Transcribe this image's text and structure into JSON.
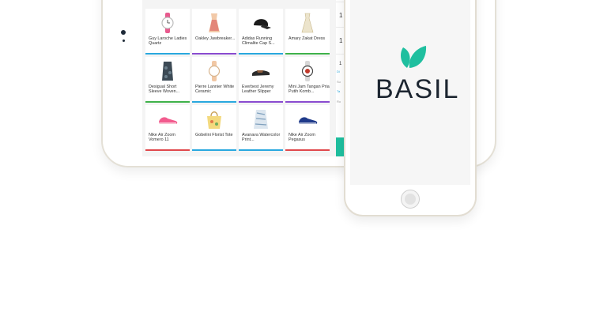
{
  "products": [
    {
      "name": "Guy Laroche Ladies Quartz",
      "color": "#29a8df",
      "icon": "watch-icon"
    },
    {
      "name": "Oakley Jawbreaker...",
      "color": "#8a4bd0",
      "icon": "dress-icon"
    },
    {
      "name": "Adidas Running Climalite Cap S...",
      "color": "#29a8df",
      "icon": "cap-icon"
    },
    {
      "name": "Amary Zakat Dress",
      "color": "#3fb24a",
      "icon": "dress-icon"
    },
    {
      "name": "Desigual Short Sleeve Woven...",
      "color": "#3fb24a",
      "icon": "dress-icon"
    },
    {
      "name": "Pierre Lannier White Ceramic",
      "color": "#29a8df",
      "icon": "watch-icon"
    },
    {
      "name": "Everbest Jeremy Leather Slipper",
      "color": "#8a4bd0",
      "icon": "slipper-icon"
    },
    {
      "name": "Mini Jam Tangan Pria Putih Komb...",
      "color": "#8a4bd0",
      "icon": "watch-icon"
    },
    {
      "name": "Nike Air Zoom Vomero 11",
      "color": "#e0484c",
      "icon": "shoe-icon"
    },
    {
      "name": "Gobelini Florist Tote",
      "color": "#29a8df",
      "icon": "bag-icon"
    },
    {
      "name": "Avanava Watercolor Print...",
      "color": "#29a8df",
      "icon": "top-icon"
    },
    {
      "name": "Nike Air Zoom Pegasus",
      "color": "#e0484c",
      "icon": "shoe-icon"
    }
  ],
  "cart": {
    "quantities": [
      "1",
      "1",
      "1",
      "1"
    ],
    "labels": [
      "Di",
      "Su",
      "Ta",
      "Ro"
    ]
  },
  "brand": {
    "name": "BASIL",
    "leaf_color": "#1fbf9f",
    "text_color": "#1c2530"
  },
  "colors": {
    "accent": "#1fbf9f",
    "bezel": "#e4e0d6"
  }
}
